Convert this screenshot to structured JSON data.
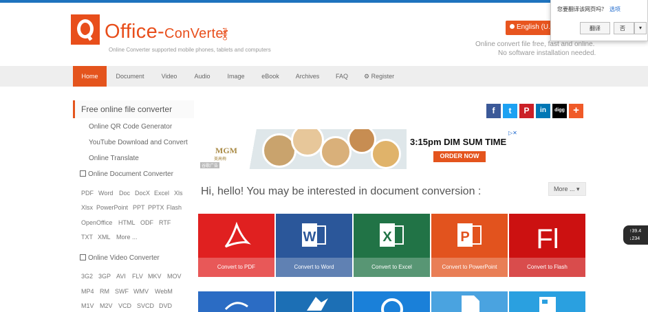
{
  "site": {
    "logo_main": "Office",
    "logo_dash": "-",
    "logo_conv": "ConVerter",
    "logo_com": "COM",
    "logo_sub": "Online Converter supported mobile phones, tablets and computers",
    "lang_button": "English (U.S.)",
    "tagline1": "Online convert file free, fast and online.",
    "tagline2": "No software installation needed."
  },
  "translate_popup": {
    "question": "您要翻译该网页吗？",
    "options_link": "选项",
    "translate_button": "翻译",
    "no_button": "否",
    "dropdown_icon": "▾"
  },
  "nav": {
    "items": [
      {
        "label": "Home"
      },
      {
        "label": "Document"
      },
      {
        "label": "Video"
      },
      {
        "label": "Audio"
      },
      {
        "label": "Image"
      },
      {
        "label": "eBook"
      },
      {
        "label": "Archives"
      },
      {
        "label": "FAQ"
      },
      {
        "label": "Register"
      }
    ]
  },
  "sidebar": {
    "title": "Free online file converter",
    "links": [
      "Online QR Code Generator",
      "YouTube Download and Convert",
      "Online Translate"
    ],
    "doc_head": "Online Document Converter",
    "doc_formats": [
      [
        "PDF",
        "Word",
        "Doc",
        "DocX",
        "Excel",
        "Xls"
      ],
      [
        "Xlsx",
        "PowerPoint",
        "PPT",
        "PPTX",
        "Flash"
      ],
      [
        "OpenOffice",
        "HTML",
        "ODF",
        "RTF"
      ],
      [
        "TXT",
        "XML",
        "More ..."
      ]
    ],
    "video_head": "Online Video Converter",
    "video_formats": [
      [
        "3G2",
        "3GP",
        "AVI",
        "FLV",
        "MKV",
        "MOV"
      ],
      [
        "MP4",
        "RM",
        "SWF",
        "WMV",
        "WebM"
      ],
      [
        "M1V",
        "M2V",
        "VCD",
        "SVCD",
        "DVD"
      ]
    ]
  },
  "social": [
    {
      "icon": "facebook-icon",
      "glyph": "f",
      "color": "#3b5998"
    },
    {
      "icon": "twitter-icon",
      "glyph": "t",
      "color": "#1da1f2"
    },
    {
      "icon": "pinterest-icon",
      "glyph": "P",
      "color": "#cb2027"
    },
    {
      "icon": "linkedin-icon",
      "glyph": "in",
      "color": "#0077b5"
    },
    {
      "icon": "digg-icon",
      "glyph": "digg",
      "color": "#000000"
    },
    {
      "icon": "plus-icon",
      "glyph": "+",
      "color": "#f05a28"
    }
  ],
  "ad": {
    "brand": "MGM",
    "brand_cn": "美高梅",
    "headline": "3:15pm DIM SUM TIME",
    "cta": "ORDER NOW",
    "tag": "谷歌广告",
    "close_icon": "▷✕"
  },
  "main": {
    "hello": "Hi, hello! You may be interested in document conversion :",
    "more_button": "More ...",
    "tiles": [
      {
        "label": "Convert to PDF",
        "color": "#e02020",
        "icon": "pdf-icon"
      },
      {
        "label": "Convert to Word",
        "color": "#2b579a",
        "icon": "word-icon"
      },
      {
        "label": "Convert to Excel",
        "color": "#217346",
        "icon": "excel-icon"
      },
      {
        "label": "Convert to PowerPoint",
        "color": "#e2531e",
        "icon": "powerpoint-icon"
      },
      {
        "label": "Convert to Flash",
        "color": "#cc1111",
        "icon": "flash-icon"
      }
    ],
    "tiles_row2_colors": [
      "#2b6cc4",
      "#1c6fb5",
      "#1a80d9",
      "#4aa3e0",
      "#2aa0e0"
    ]
  },
  "speed_widget": {
    "up": "↑39.4",
    "down": "↓234"
  },
  "colors": {
    "accent": "#e4541d",
    "top_bar": "#1e73be"
  }
}
